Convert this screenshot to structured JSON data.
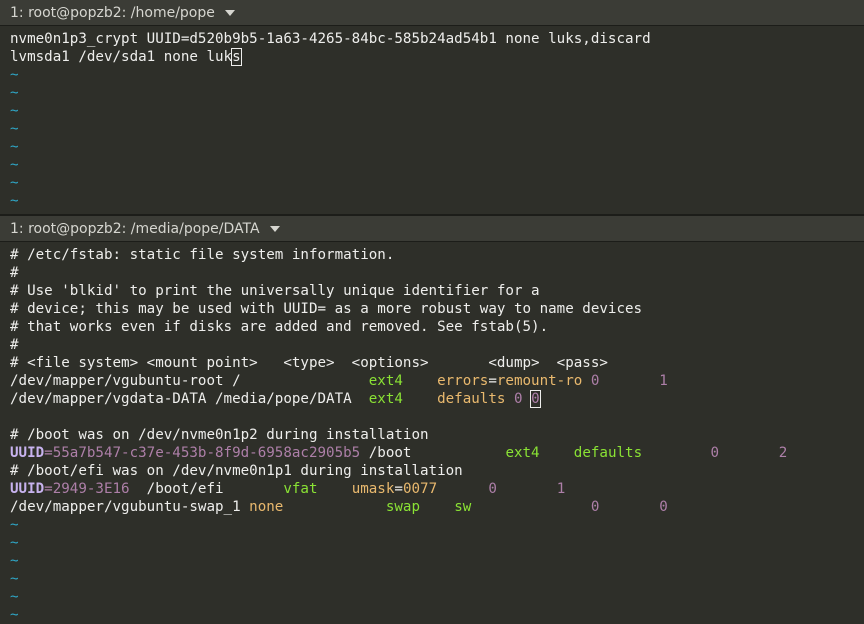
{
  "top_pane": {
    "title": "1: root@popzb2: /home/pope",
    "lines": [
      "nvme0n1p3_crypt UUID=d520b9b5-1a63-4265-84bc-585b24ad54b1 none luks,discard",
      "lvmsda1 /dev/sda1 none luk",
      "s"
    ],
    "tilde": "~"
  },
  "bottom_pane": {
    "title": "1: root@popzb2: /media/pope/DATA",
    "comments": [
      "# /etc/fstab: static file system information.",
      "#",
      "# Use 'blkid' to print the universally unique identifier for a",
      "# device; this may be used with UUID= as a more robust way to name devices",
      "# that works even if disks are added and removed. See fstab(5).",
      "#",
      "# <file system> <mount point>   <type>  <options>       <dump>  <pass>"
    ],
    "root_line": {
      "device": "/dev/mapper/vgubuntu-root /               ",
      "type": "ext4",
      "gap1": "    ",
      "opt_a": "errors",
      "opt_eq": "=",
      "opt_b": "remount-ro",
      "dump": " 0",
      "pass": "       1"
    },
    "data_line": {
      "device": "/dev/mapper/vgdata-DATA /media/pope/DATA  ",
      "type": "ext4",
      "gap1": "    ",
      "opt": "defaults",
      "dump": " 0 ",
      "pass": "0"
    },
    "boot_comment": "# /boot was on /dev/nvme0n1p2 during installation",
    "boot_line": {
      "key": "UUID",
      "eq": "=",
      "uuid": "55a7b547-c37e-453b-8f9d-6958ac2905b5",
      "mount": " /boot           ",
      "type": "ext4",
      "gap": "    ",
      "opt": "defaults",
      "dump": "        0",
      "pass": "       2"
    },
    "efi_comment": "# /boot/efi was on /dev/nvme0n1p1 during installation",
    "efi_line": {
      "key": "UUID",
      "eq": "=",
      "uuid": "2949-3E16",
      "mount": "  /boot/efi       ",
      "type": "vfat",
      "gap": "    ",
      "opt_a": "umask",
      "opt_eq": "=",
      "opt_b": "0077",
      "dump": "      0",
      "pass": "       1"
    },
    "swap_line": {
      "device": "/dev/mapper/vgubuntu-swap_1 ",
      "none": "none",
      "gap": "            ",
      "type": "swap",
      "gap2": "    ",
      "opt": "sw",
      "dump": "              0",
      "pass": "       0"
    },
    "tilde": "~"
  },
  "colors": {
    "background": "#2e2f29",
    "tilde": "#2fa6c6",
    "keyword": "#c8b3ef",
    "number": "#ad7fa8",
    "type": "#8ae234",
    "option": "#e9b96e"
  }
}
